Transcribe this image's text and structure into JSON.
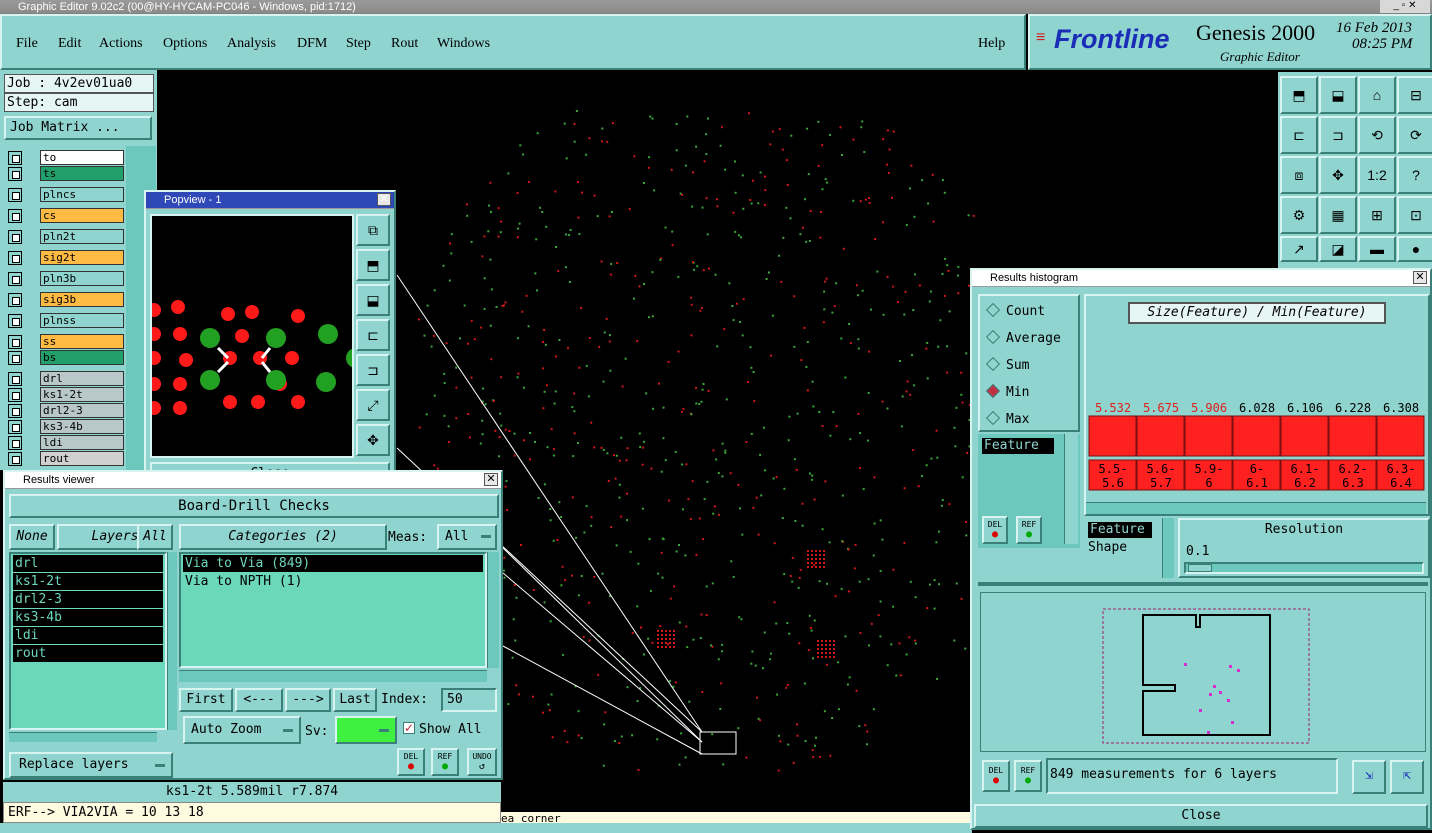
{
  "window_title": "Graphic Editor 9.02c2 (00@HY-HYCAM-PC046 - Windows, pid:1712)",
  "menu": [
    "File",
    "Edit",
    "Actions",
    "Options",
    "Analysis",
    "DFM",
    "Step",
    "Rout",
    "Windows"
  ],
  "help_label": "Help",
  "brand": {
    "logo": "Frontline",
    "product": "Genesis 2000",
    "subtitle": "Graphic Editor",
    "date": "16 Feb 2013",
    "time": "08:25 PM"
  },
  "job": {
    "job_label": "Job : 4v2ev01ua0",
    "step_label": "Step: cam",
    "matrix_button": "Job Matrix ..."
  },
  "layers": [
    {
      "name": "to",
      "color": "#ffffff"
    },
    {
      "name": "ts",
      "color": "#22a06b"
    },
    {
      "name": "plncs",
      "color": "#8fd4ce"
    },
    {
      "name": "cs",
      "color": "#ffbb44"
    },
    {
      "name": "pln2t",
      "color": "#8fd4ce"
    },
    {
      "name": "sig2t",
      "color": "#ffbb44"
    },
    {
      "name": "pln3b",
      "color": "#8fd4ce"
    },
    {
      "name": "sig3b",
      "color": "#ffbb44"
    },
    {
      "name": "plnss",
      "color": "#8fd4ce"
    },
    {
      "name": "ss",
      "color": "#ffbb44"
    },
    {
      "name": "bs",
      "color": "#22a06b"
    },
    {
      "name": "drl",
      "color": "#b8c8c8"
    },
    {
      "name": "ks1-2t",
      "color": "#b8c8c8"
    },
    {
      "name": "drl2-3",
      "color": "#b8c8c8"
    },
    {
      "name": "ks3-4b",
      "color": "#b8c8c8"
    },
    {
      "name": "ldi",
      "color": "#b8c8c8"
    },
    {
      "name": "rout",
      "color": "#d0d0d0"
    }
  ],
  "popview": {
    "title": "Popview - 1",
    "close_label": "Close"
  },
  "results_viewer": {
    "title": "Results viewer",
    "check_name": "Board-Drill Checks",
    "none_label": "None",
    "layers_label": "Layers",
    "all_label": "All",
    "categories_label": "Categories (2)",
    "meas_label": "Meas:",
    "meas_value": "All",
    "layer_list": [
      "drl",
      "ks1-2t",
      "drl2-3",
      "ks3-4b",
      "ldi",
      "rout"
    ],
    "categories": [
      "Via to Via  (849)",
      "Via to NPTH  (1)"
    ],
    "first_label": "First",
    "prev_label": "<---",
    "next_label": "--->",
    "last_label": "Last",
    "index_label": "Index:",
    "index_value": "50",
    "autozoom_label": "Auto Zoom",
    "sv_label": "Sv:",
    "show_all_label": "Show All",
    "replace_label": "Replace layers",
    "del_label": "DEL",
    "ref_label": "REF",
    "undo_label": "UNDO"
  },
  "status": {
    "measurement": "ks1-2t  5.589mil  r7.874",
    "erf": "ERF--> VIA2VIA = 10 13 18",
    "hint": "ea corner"
  },
  "histogram": {
    "title": "Results histogram",
    "options": [
      "Count",
      "Average",
      "Sum",
      "Min",
      "Max"
    ],
    "selected": "Min",
    "formula": "Size(Feature) / Min(Feature)",
    "list_left": [
      "Feature"
    ],
    "attr_list": [
      "Feature",
      "Shape"
    ],
    "resolution_label": "Resolution",
    "resolution_value": "0.1",
    "del_label": "DEL",
    "ref_label": "REF",
    "summary": "849 measurements for 6 layers",
    "close_label": "Close"
  },
  "chart_data": {
    "type": "bar",
    "categories": [
      "5.5-5.6",
      "5.6-5.7",
      "5.9-6",
      "6-6.1",
      "6.1-6.2",
      "6.2-6.3",
      "6.3-6.4"
    ],
    "values": [
      5.532,
      5.675,
      5.906,
      6.028,
      6.106,
      6.228,
      6.308
    ],
    "value_colors": [
      "#e0201c",
      "#e0201c",
      "#e0201c",
      "#000000",
      "#000000",
      "#000000",
      "#000000"
    ],
    "bar_color": "#ff2020"
  },
  "toolbar_icons": [
    "open-icon",
    "save-icon",
    "home-icon",
    "panel-icon",
    "zoom-in-icon",
    "zoom-out-icon",
    "zoom-home-icon",
    "measure-icon",
    "fit-icon",
    "center-icon",
    "scale-icon",
    "help-icon",
    "settings-icon",
    "grid-icon",
    "drc-icon",
    "drill-icon",
    "pointer-icon",
    "snap-icon",
    "ruler-icon",
    "dot-icon"
  ]
}
